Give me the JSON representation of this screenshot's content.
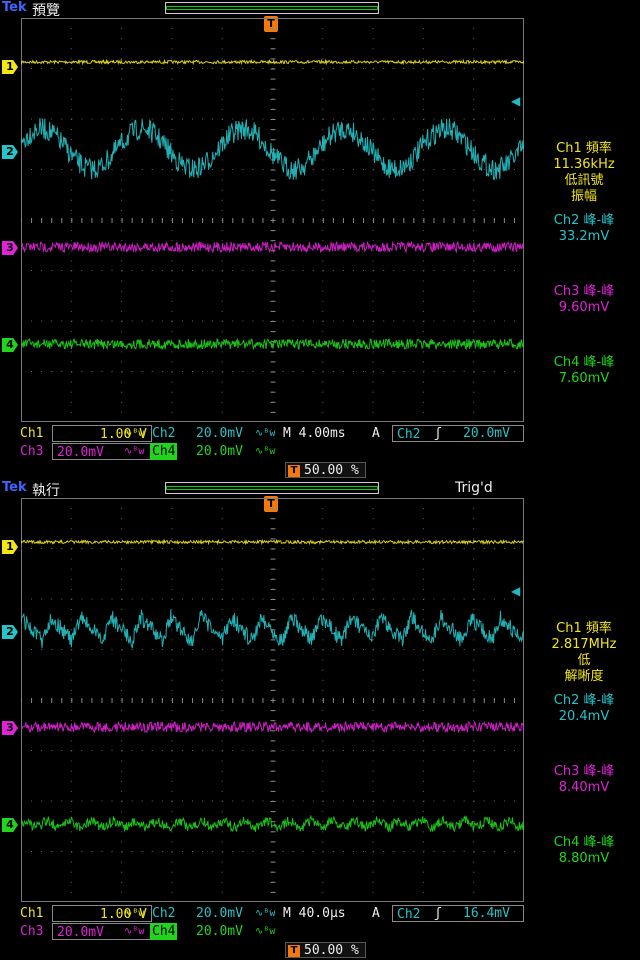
{
  "colors": {
    "ch1": "#f2e61a",
    "ch2": "#26c3c8",
    "ch3": "#e023d6",
    "ch4": "#20d51c",
    "trigger": "#f07a10",
    "brand": "#3b67ff"
  },
  "screens": [
    {
      "brand": "Tek",
      "mode": "預覽",
      "trig_status": "",
      "trigger_marker": "T",
      "channel_markers": [
        "1",
        "2",
        "3",
        "4"
      ],
      "measurements": [
        {
          "lines": [
            "Ch1 頻率",
            "11.36kHz",
            "低訊號",
            "振幅"
          ]
        },
        {
          "lines": [
            "Ch2 峰-峰",
            "33.2mV"
          ]
        },
        {
          "lines": [
            "Ch3 峰-峰",
            "9.60mV"
          ]
        },
        {
          "lines": [
            "Ch4 峰-峰",
            "7.60mV"
          ]
        }
      ],
      "bottom": {
        "ch1_label": "Ch1",
        "ch1_scale": "1.00 V",
        "ch2_label": "Ch2",
        "ch2_scale": "20.0mV",
        "ch3_label": "Ch3",
        "ch3_scale": "20.0mV",
        "ch4_label": "Ch4",
        "ch4_scale": "20.0mV",
        "bw_icon": "∿ᴮw",
        "timebase": "M 4.00ms",
        "trig_mode": "A",
        "trig_source": "Ch2",
        "trig_slope": "ʃ",
        "trig_level": "20.0mV",
        "position": "50.00 %"
      }
    },
    {
      "brand": "Tek",
      "mode": "執行",
      "trig_status": "Trig'd",
      "trigger_marker": "T",
      "channel_markers": [
        "1",
        "2",
        "3",
        "4"
      ],
      "measurements": [
        {
          "lines": [
            "Ch1 頻率",
            "2.817MHz",
            "低",
            "解晰度"
          ]
        },
        {
          "lines": [
            "Ch2 峰-峰",
            "20.4mV"
          ]
        },
        {
          "lines": [
            "Ch3 峰-峰",
            "8.40mV"
          ]
        },
        {
          "lines": [
            "Ch4 峰-峰",
            "8.80mV"
          ]
        }
      ],
      "bottom": {
        "ch1_label": "Ch1",
        "ch1_scale": "1.00 V",
        "ch2_label": "Ch2",
        "ch2_scale": "20.0mV",
        "ch3_label": "Ch3",
        "ch3_scale": "20.0mV",
        "ch4_label": "Ch4",
        "ch4_scale": "20.0mV",
        "bw_icon": "∿ᴮw",
        "timebase": "M 40.0µs",
        "trig_mode": "A",
        "trig_source": "Ch2",
        "trig_slope": "ʃ",
        "trig_level": "16.4mV",
        "position": "50.00 %"
      }
    }
  ]
}
